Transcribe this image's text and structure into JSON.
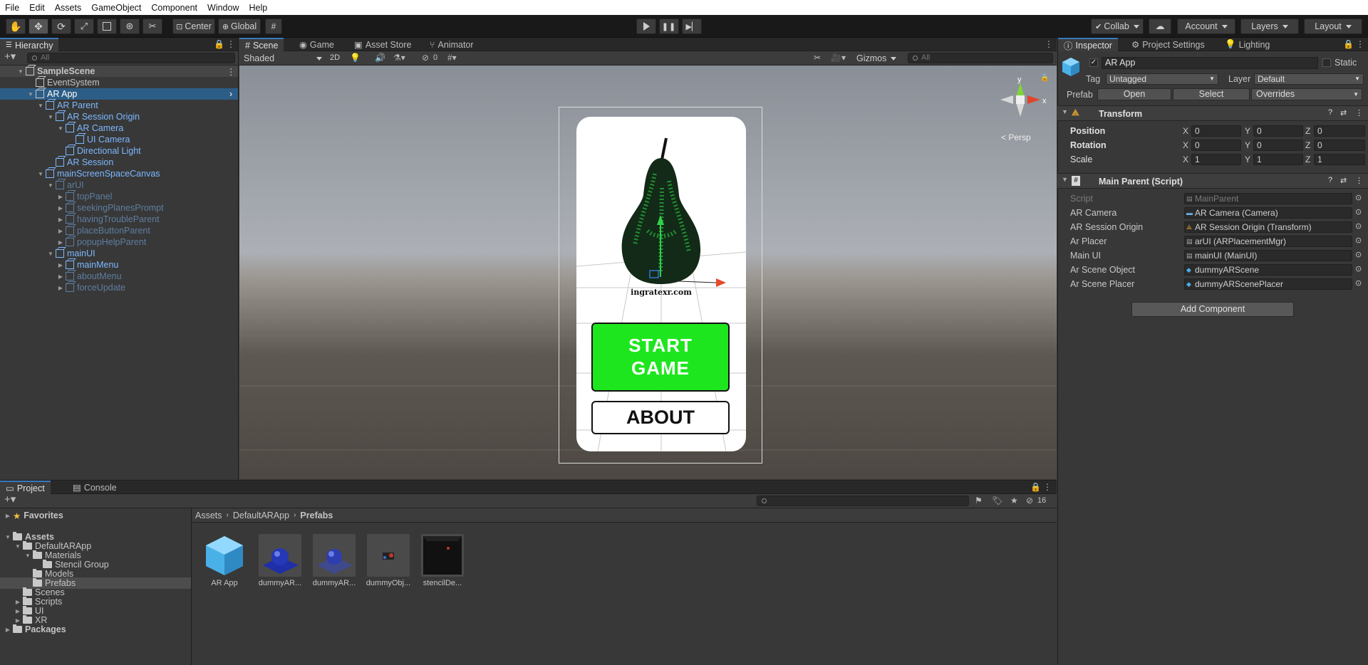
{
  "menu": [
    "File",
    "Edit",
    "Assets",
    "GameObject",
    "Component",
    "Window",
    "Help"
  ],
  "toolbar": {
    "pivot": "Center",
    "space": "Global",
    "collab": "Collab",
    "account": "Account",
    "layers": "Layers",
    "layout": "Layout"
  },
  "hierarchy": {
    "tab": "Hierarchy",
    "search_placeholder": "All",
    "items": [
      {
        "label": "SampleScene",
        "indent": 0
      },
      {
        "label": "EventSystem",
        "indent": 1
      },
      {
        "label": "AR App",
        "indent": 1
      },
      {
        "label": "AR Parent",
        "indent": 2
      },
      {
        "label": "AR Session Origin",
        "indent": 3
      },
      {
        "label": "AR Camera",
        "indent": 4
      },
      {
        "label": "UI Camera",
        "indent": 5
      },
      {
        "label": "Directional Light",
        "indent": 4
      },
      {
        "label": "AR Session",
        "indent": 3
      },
      {
        "label": "mainScreenSpaceCanvas",
        "indent": 2
      },
      {
        "label": "arUI",
        "indent": 3
      },
      {
        "label": "topPanel",
        "indent": 4
      },
      {
        "label": "seekingPlanesPrompt",
        "indent": 4
      },
      {
        "label": "havingTroubleParent",
        "indent": 4
      },
      {
        "label": "placeButtonParent",
        "indent": 4
      },
      {
        "label": "popupHelpParent",
        "indent": 4
      },
      {
        "label": "mainUI",
        "indent": 3
      },
      {
        "label": "mainMenu",
        "indent": 4
      },
      {
        "label": "aboutMenu",
        "indent": 4
      },
      {
        "label": "forceUpdate",
        "indent": 4
      }
    ]
  },
  "scene": {
    "tabs": [
      "Scene",
      "Game",
      "Asset Store",
      "Animator"
    ],
    "shading": "Shaded",
    "mode_2d": "2D",
    "hidden_count": "0",
    "gizmos": "Gizmos",
    "search_placeholder": "All",
    "persp_label": "< Persp",
    "axis_y": "y",
    "axis_x": "x",
    "phone": {
      "website": "ingratexr.com",
      "start_line1": "START",
      "start_line2": "GAME",
      "about": "ABOUT"
    }
  },
  "inspector": {
    "tabs": [
      "Inspector",
      "Project Settings",
      "Lighting"
    ],
    "object_name": "AR App",
    "static_label": "Static",
    "tag_label": "Tag",
    "tag_value": "Untagged",
    "layer_label": "Layer",
    "layer_value": "Default",
    "prefab_label": "Prefab",
    "prefab_open": "Open",
    "prefab_select": "Select",
    "prefab_overrides": "Overrides",
    "transform": {
      "title": "Transform",
      "position_label": "Position",
      "rotation_label": "Rotation",
      "scale_label": "Scale",
      "position": [
        "0",
        "0",
        "0"
      ],
      "rotation": [
        "0",
        "0",
        "0"
      ],
      "scale": [
        "1",
        "1",
        "1"
      ],
      "axes": [
        "X",
        "Y",
        "Z"
      ]
    },
    "script": {
      "title": "Main Parent (Script)",
      "fields": [
        {
          "label": "Script",
          "value": "MainParent"
        },
        {
          "label": "AR Camera",
          "value": "AR Camera (Camera)"
        },
        {
          "label": "AR Session Origin",
          "value": "AR Session Origin (Transform)"
        },
        {
          "label": "Ar Placer",
          "value": "arUI (ARPlacementMgr)"
        },
        {
          "label": "Main UI",
          "value": "mainUI (MainUI)"
        },
        {
          "label": "Ar Scene Object",
          "value": "dummyARScene"
        },
        {
          "label": "Ar Scene Placer",
          "value": "dummyARScenePlacer"
        }
      ]
    },
    "add_component": "Add Component"
  },
  "project": {
    "tabs": [
      "Project",
      "Console"
    ],
    "hidden_count": "16",
    "breadcrumb": [
      "Assets",
      "DefaultARApp",
      "Prefabs"
    ],
    "tree": [
      {
        "label": "Favorites",
        "indent": 0
      },
      {
        "label": "Assets",
        "indent": 0
      },
      {
        "label": "DefaultARApp",
        "indent": 1
      },
      {
        "label": "Materials",
        "indent": 2
      },
      {
        "label": "Stencil Group",
        "indent": 3
      },
      {
        "label": "Models",
        "indent": 2
      },
      {
        "label": "Prefabs",
        "indent": 2
      },
      {
        "label": "Scenes",
        "indent": 1
      },
      {
        "label": "Scripts",
        "indent": 1
      },
      {
        "label": "UI",
        "indent": 1
      },
      {
        "label": "XR",
        "indent": 1
      },
      {
        "label": "Packages",
        "indent": 0
      }
    ],
    "assets": [
      "AR App",
      "dummyAR...",
      "dummyAR...",
      "dummyObj...",
      "stencilDe..."
    ]
  },
  "colors": {
    "accent": "#2c5d87",
    "prefab_blue": "#7cb8ff",
    "start_button": "#1ee61e"
  }
}
